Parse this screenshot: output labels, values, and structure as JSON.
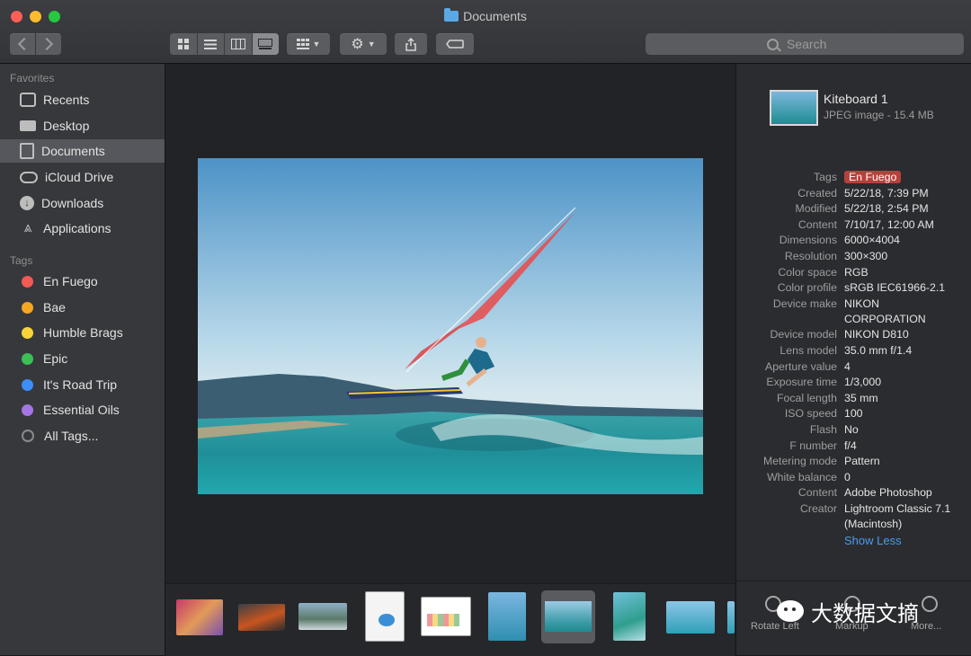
{
  "window": {
    "title": "Documents"
  },
  "toolbar": {
    "search_placeholder": "Search"
  },
  "sidebar": {
    "favorites_heading": "Favorites",
    "favorites": [
      {
        "label": "Recents",
        "icon": "clock-icon"
      },
      {
        "label": "Desktop",
        "icon": "desktop-icon"
      },
      {
        "label": "Documents",
        "icon": "documents-icon",
        "selected": true
      },
      {
        "label": "iCloud Drive",
        "icon": "cloud-icon"
      },
      {
        "label": "Downloads",
        "icon": "download-icon"
      },
      {
        "label": "Applications",
        "icon": "applications-icon"
      }
    ],
    "tags_heading": "Tags",
    "tags": [
      {
        "label": "En Fuego",
        "color": "#f25a54"
      },
      {
        "label": "Bae",
        "color": "#f5a623"
      },
      {
        "label": "Humble Brags",
        "color": "#f8d43a"
      },
      {
        "label": "Epic",
        "color": "#3ac055"
      },
      {
        "label": "It's Road Trip",
        "color": "#3d8ef5"
      },
      {
        "label": "Essential Oils",
        "color": "#a575e3"
      },
      {
        "label": "All Tags...",
        "color": "none"
      }
    ]
  },
  "inspector": {
    "file_name": "Kiteboard 1",
    "file_type": "JPEG image - 15.4 MB",
    "metadata": [
      {
        "key": "Tags",
        "value": "En Fuego",
        "is_tag": true
      },
      {
        "key": "Created",
        "value": "5/22/18, 7:39 PM"
      },
      {
        "key": "Modified",
        "value": "5/22/18, 2:54 PM"
      },
      {
        "key": "Content",
        "value": "7/10/17, 12:00 AM"
      },
      {
        "key": "Dimensions",
        "value": "6000×4004"
      },
      {
        "key": "Resolution",
        "value": "300×300"
      },
      {
        "key": "Color space",
        "value": "RGB"
      },
      {
        "key": "Color profile",
        "value": "sRGB IEC61966-2.1"
      },
      {
        "key": "Device make",
        "value": "NIKON",
        "value2": "CORPORATION"
      },
      {
        "key": "Device model",
        "value": "NIKON D810"
      },
      {
        "key": "Lens model",
        "value": "35.0 mm f/1.4"
      },
      {
        "key": "Aperture value",
        "value": "4"
      },
      {
        "key": "Exposure time",
        "value": "1/3,000"
      },
      {
        "key": "Focal length",
        "value": "35 mm"
      },
      {
        "key": "ISO speed",
        "value": "100"
      },
      {
        "key": "Flash",
        "value": "No"
      },
      {
        "key": "F number",
        "value": "f/4"
      },
      {
        "key": "Metering mode",
        "value": "Pattern"
      },
      {
        "key": "White balance",
        "value": "0"
      },
      {
        "key": "Content",
        "value": "Adobe Photoshop"
      },
      {
        "key": "Creator",
        "value": "Lightroom Classic 7.1",
        "value2": "(Macintosh)"
      }
    ],
    "show_less": "Show Less",
    "actions": [
      "Rotate Left",
      "Markup",
      "More..."
    ]
  },
  "watermark": "大数据文摘"
}
